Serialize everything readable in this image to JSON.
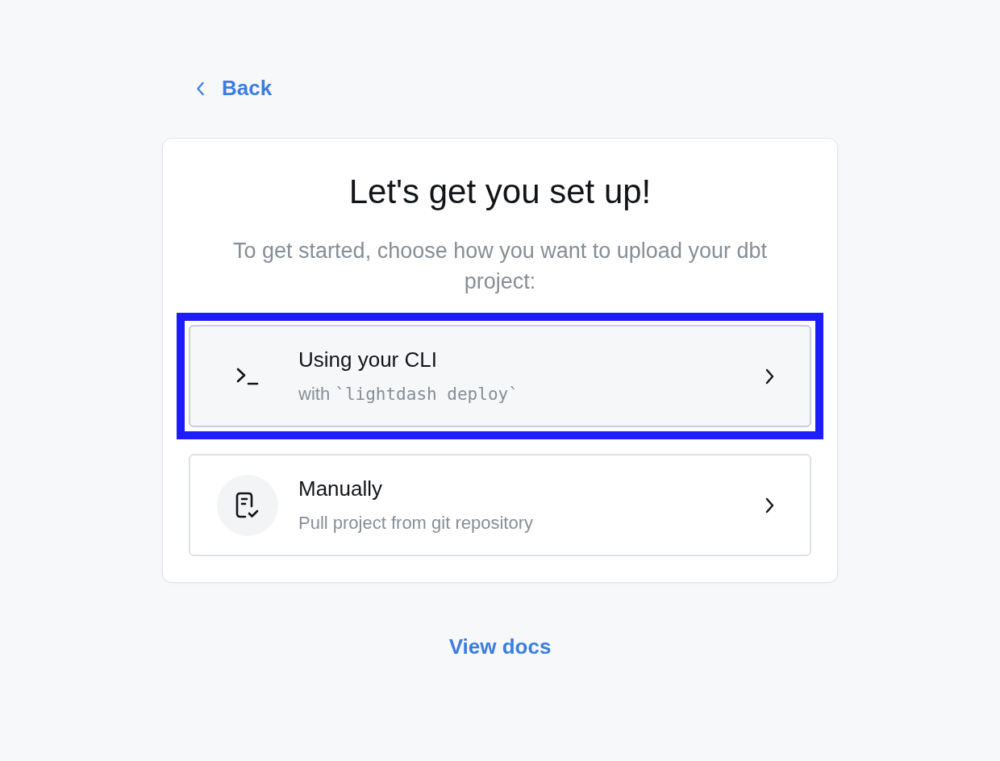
{
  "back_link": {
    "label": "Back"
  },
  "card": {
    "title": "Let's get you set up!",
    "subtitle": "To get started, choose how you want to upload your dbt project:",
    "options": [
      {
        "kind": "cli",
        "title": "Using your CLI",
        "description": "with",
        "description_code": "`lightdash deploy`",
        "selected": true
      },
      {
        "kind": "manual",
        "title": "Manually",
        "description": "Pull project from git repository",
        "selected": false
      }
    ]
  },
  "docs_link": {
    "label": "View docs"
  }
}
